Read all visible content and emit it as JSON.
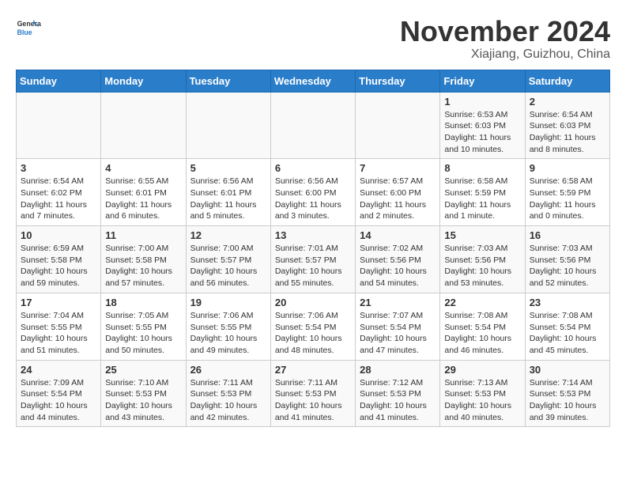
{
  "header": {
    "logo_general": "General",
    "logo_blue": "Blue",
    "title": "November 2024",
    "subtitle": "Xiajiang, Guizhou, China"
  },
  "columns": [
    "Sunday",
    "Monday",
    "Tuesday",
    "Wednesday",
    "Thursday",
    "Friday",
    "Saturday"
  ],
  "weeks": [
    [
      {
        "day": "",
        "info": ""
      },
      {
        "day": "",
        "info": ""
      },
      {
        "day": "",
        "info": ""
      },
      {
        "day": "",
        "info": ""
      },
      {
        "day": "",
        "info": ""
      },
      {
        "day": "1",
        "info": "Sunrise: 6:53 AM\nSunset: 6:03 PM\nDaylight: 11 hours and 10 minutes."
      },
      {
        "day": "2",
        "info": "Sunrise: 6:54 AM\nSunset: 6:03 PM\nDaylight: 11 hours and 8 minutes."
      }
    ],
    [
      {
        "day": "3",
        "info": "Sunrise: 6:54 AM\nSunset: 6:02 PM\nDaylight: 11 hours and 7 minutes."
      },
      {
        "day": "4",
        "info": "Sunrise: 6:55 AM\nSunset: 6:01 PM\nDaylight: 11 hours and 6 minutes."
      },
      {
        "day": "5",
        "info": "Sunrise: 6:56 AM\nSunset: 6:01 PM\nDaylight: 11 hours and 5 minutes."
      },
      {
        "day": "6",
        "info": "Sunrise: 6:56 AM\nSunset: 6:00 PM\nDaylight: 11 hours and 3 minutes."
      },
      {
        "day": "7",
        "info": "Sunrise: 6:57 AM\nSunset: 6:00 PM\nDaylight: 11 hours and 2 minutes."
      },
      {
        "day": "8",
        "info": "Sunrise: 6:58 AM\nSunset: 5:59 PM\nDaylight: 11 hours and 1 minute."
      },
      {
        "day": "9",
        "info": "Sunrise: 6:58 AM\nSunset: 5:59 PM\nDaylight: 11 hours and 0 minutes."
      }
    ],
    [
      {
        "day": "10",
        "info": "Sunrise: 6:59 AM\nSunset: 5:58 PM\nDaylight: 10 hours and 59 minutes."
      },
      {
        "day": "11",
        "info": "Sunrise: 7:00 AM\nSunset: 5:58 PM\nDaylight: 10 hours and 57 minutes."
      },
      {
        "day": "12",
        "info": "Sunrise: 7:00 AM\nSunset: 5:57 PM\nDaylight: 10 hours and 56 minutes."
      },
      {
        "day": "13",
        "info": "Sunrise: 7:01 AM\nSunset: 5:57 PM\nDaylight: 10 hours and 55 minutes."
      },
      {
        "day": "14",
        "info": "Sunrise: 7:02 AM\nSunset: 5:56 PM\nDaylight: 10 hours and 54 minutes."
      },
      {
        "day": "15",
        "info": "Sunrise: 7:03 AM\nSunset: 5:56 PM\nDaylight: 10 hours and 53 minutes."
      },
      {
        "day": "16",
        "info": "Sunrise: 7:03 AM\nSunset: 5:56 PM\nDaylight: 10 hours and 52 minutes."
      }
    ],
    [
      {
        "day": "17",
        "info": "Sunrise: 7:04 AM\nSunset: 5:55 PM\nDaylight: 10 hours and 51 minutes."
      },
      {
        "day": "18",
        "info": "Sunrise: 7:05 AM\nSunset: 5:55 PM\nDaylight: 10 hours and 50 minutes."
      },
      {
        "day": "19",
        "info": "Sunrise: 7:06 AM\nSunset: 5:55 PM\nDaylight: 10 hours and 49 minutes."
      },
      {
        "day": "20",
        "info": "Sunrise: 7:06 AM\nSunset: 5:54 PM\nDaylight: 10 hours and 48 minutes."
      },
      {
        "day": "21",
        "info": "Sunrise: 7:07 AM\nSunset: 5:54 PM\nDaylight: 10 hours and 47 minutes."
      },
      {
        "day": "22",
        "info": "Sunrise: 7:08 AM\nSunset: 5:54 PM\nDaylight: 10 hours and 46 minutes."
      },
      {
        "day": "23",
        "info": "Sunrise: 7:08 AM\nSunset: 5:54 PM\nDaylight: 10 hours and 45 minutes."
      }
    ],
    [
      {
        "day": "24",
        "info": "Sunrise: 7:09 AM\nSunset: 5:54 PM\nDaylight: 10 hours and 44 minutes."
      },
      {
        "day": "25",
        "info": "Sunrise: 7:10 AM\nSunset: 5:53 PM\nDaylight: 10 hours and 43 minutes."
      },
      {
        "day": "26",
        "info": "Sunrise: 7:11 AM\nSunset: 5:53 PM\nDaylight: 10 hours and 42 minutes."
      },
      {
        "day": "27",
        "info": "Sunrise: 7:11 AM\nSunset: 5:53 PM\nDaylight: 10 hours and 41 minutes."
      },
      {
        "day": "28",
        "info": "Sunrise: 7:12 AM\nSunset: 5:53 PM\nDaylight: 10 hours and 41 minutes."
      },
      {
        "day": "29",
        "info": "Sunrise: 7:13 AM\nSunset: 5:53 PM\nDaylight: 10 hours and 40 minutes."
      },
      {
        "day": "30",
        "info": "Sunrise: 7:14 AM\nSunset: 5:53 PM\nDaylight: 10 hours and 39 minutes."
      }
    ]
  ]
}
